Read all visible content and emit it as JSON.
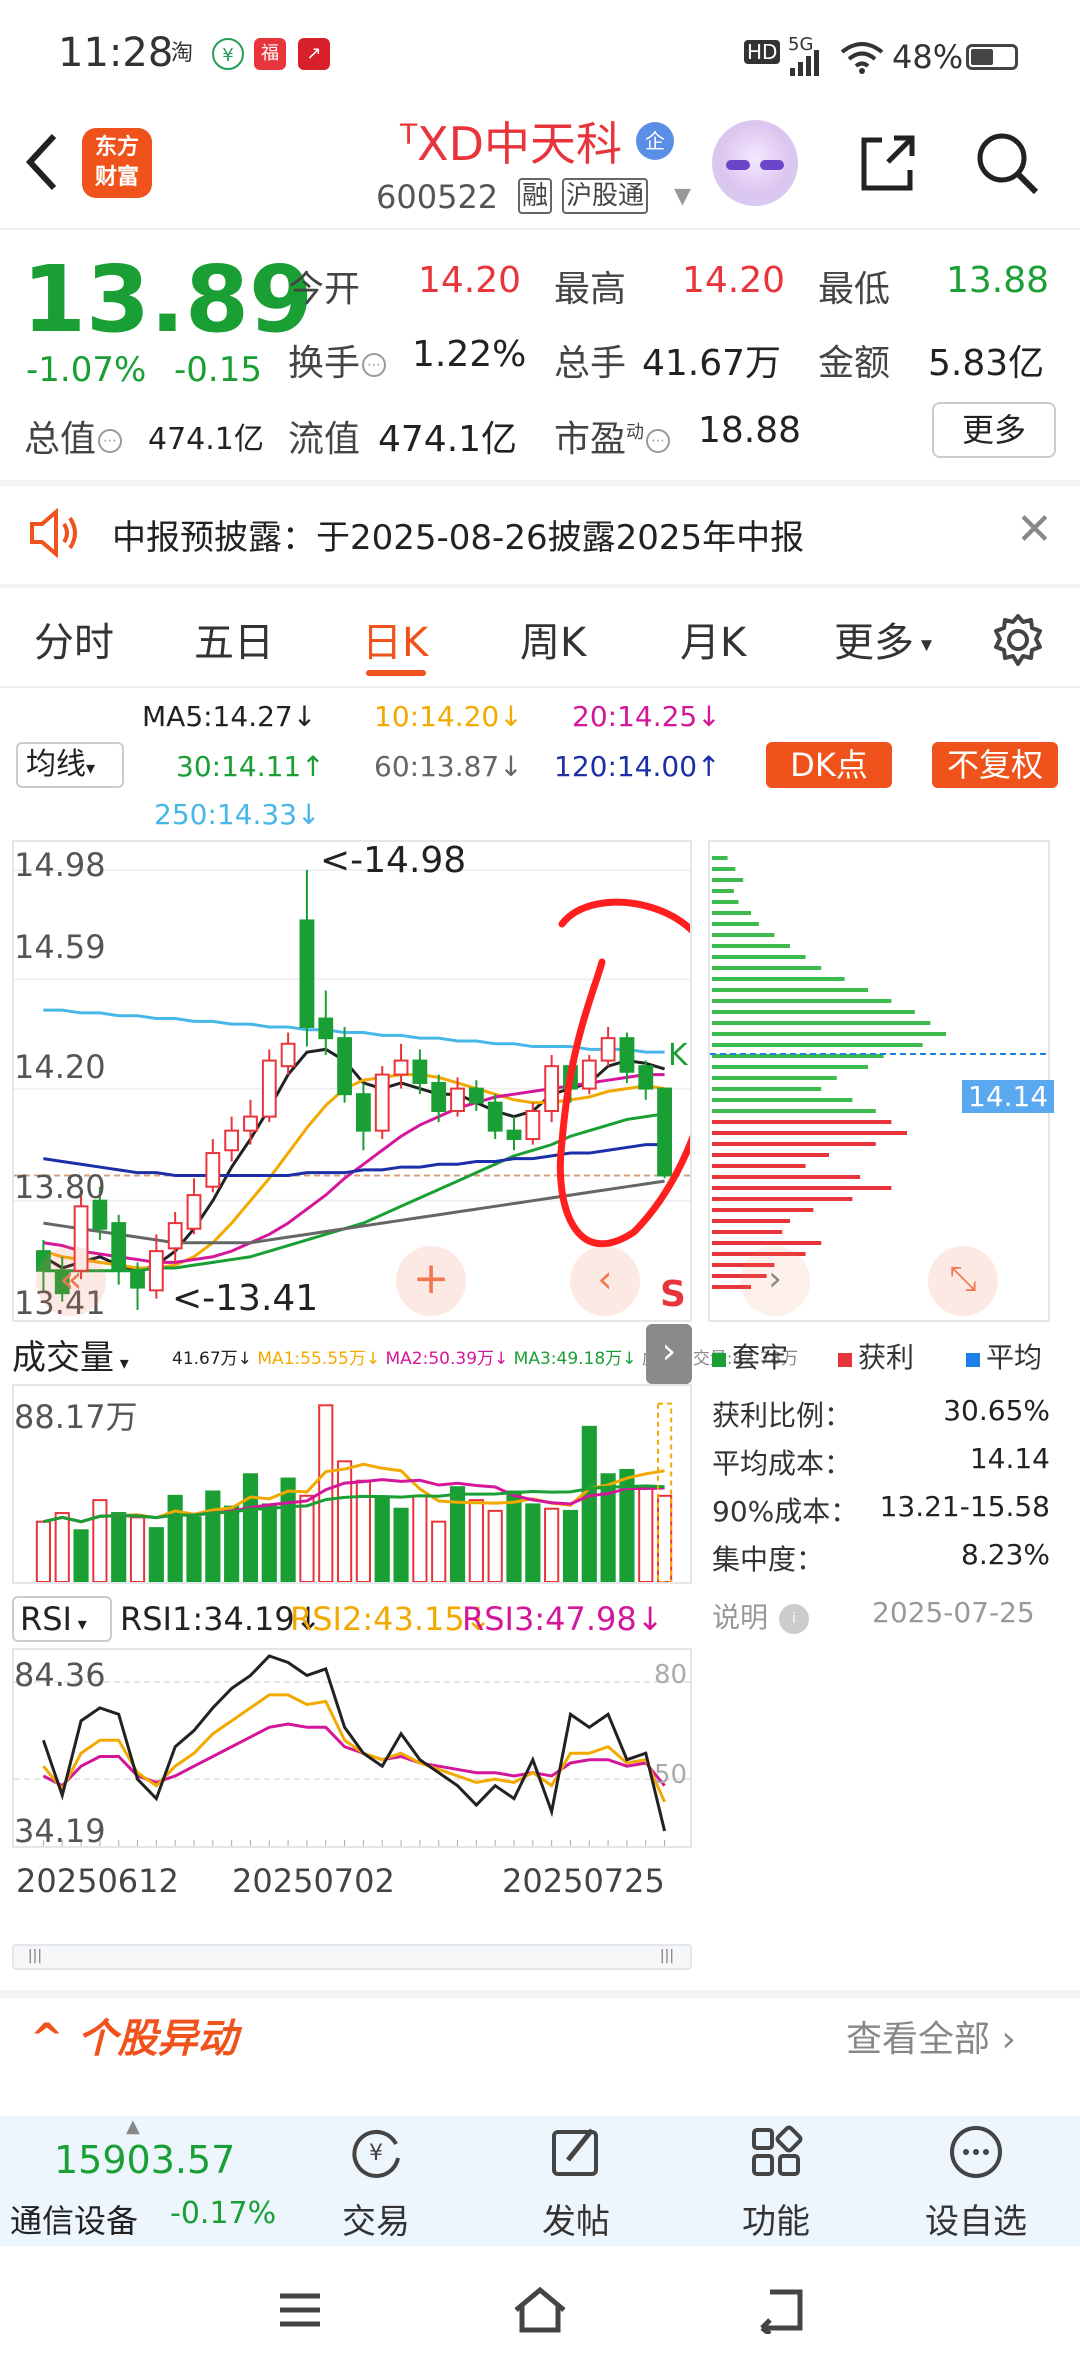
{
  "status_bar": {
    "time": "11:28",
    "battery": "48%",
    "net": "5G",
    "hd": "HD"
  },
  "header": {
    "back": "<",
    "logo_line1": "东方",
    "logo_line2": "财富",
    "prefix": "T",
    "name": "XD中天科",
    "badge": "企",
    "code": "600522",
    "tags": [
      "融",
      "沪股通"
    ]
  },
  "quote": {
    "price": "13.89",
    "change_pct": "-1.07%",
    "change": "-0.15",
    "open_label": "今开",
    "open": "14.20",
    "high_label": "最高",
    "high": "14.20",
    "low_label": "最低",
    "low": "13.88",
    "turnover_label": "换手",
    "turnover": "1.22%",
    "volume_label": "总手",
    "volume": "41.67万",
    "amount_label": "金额",
    "amount": "5.83亿",
    "mktcap_label": "总值",
    "mktcap": "474.1亿",
    "float_label": "流值",
    "float": "474.1亿",
    "pe_label": "市盈",
    "pe_sup": "动",
    "pe": "18.88",
    "more": "更多"
  },
  "notice": {
    "text": "中报预披露：于2025-08-26披露2025年中报"
  },
  "tabs": [
    "分时",
    "五日",
    "日K",
    "周K",
    "月K",
    "更多"
  ],
  "ma_legend": {
    "select": "均线",
    "ma5": "MA5:14.27↓",
    "ma10": "10:14.20↓",
    "ma20": "20:14.25↓",
    "ma30": "30:14.11↑",
    "ma60": "60:13.87↓",
    "ma120": "120:14.00↑",
    "ma250": "250:14.33↓",
    "dk": "DK点",
    "fq": "不复权",
    "colors": {
      "ma5": "#222222",
      "ma10": "#f2a900",
      "ma20": "#d4169a",
      "ma30": "#1a9f35",
      "ma60": "#666666",
      "ma120": "#1c2fa8",
      "ma250": "#47b7e8"
    }
  },
  "chart_data": [
    {
      "type": "candlestick",
      "y_ticks": [
        "14.98",
        "14.59",
        "14.20",
        "13.80",
        "13.41"
      ],
      "ylim": [
        13.41,
        14.98
      ],
      "high_annot": "<-14.98",
      "low_annot": "<-13.41",
      "last_label": "14.14",
      "s_marker": "S",
      "candles": [
        {
          "o": 13.62,
          "c": 13.55,
          "h": 13.66,
          "l": 13.48
        },
        {
          "o": 13.55,
          "c": 13.47,
          "h": 13.6,
          "l": 13.44
        },
        {
          "o": 13.55,
          "c": 13.78,
          "h": 13.83,
          "l": 13.52
        },
        {
          "o": 13.8,
          "c": 13.7,
          "h": 13.85,
          "l": 13.66
        },
        {
          "o": 13.72,
          "c": 13.55,
          "h": 13.75,
          "l": 13.5
        },
        {
          "o": 13.55,
          "c": 13.49,
          "h": 13.58,
          "l": 13.41
        },
        {
          "o": 13.48,
          "c": 13.62,
          "h": 13.68,
          "l": 13.45
        },
        {
          "o": 13.63,
          "c": 13.72,
          "h": 13.76,
          "l": 13.58
        },
        {
          "o": 13.7,
          "c": 13.82,
          "h": 13.88,
          "l": 13.68
        },
        {
          "o": 13.85,
          "c": 13.97,
          "h": 14.02,
          "l": 13.83
        },
        {
          "o": 13.98,
          "c": 14.05,
          "h": 14.1,
          "l": 13.94
        },
        {
          "o": 14.05,
          "c": 14.1,
          "h": 14.16,
          "l": 14.0
        },
        {
          "o": 14.1,
          "c": 14.3,
          "h": 14.34,
          "l": 14.08
        },
        {
          "o": 14.28,
          "c": 14.36,
          "h": 14.4,
          "l": 14.25
        },
        {
          "o": 14.8,
          "c": 14.42,
          "h": 14.98,
          "l": 14.35
        },
        {
          "o": 14.45,
          "c": 14.38,
          "h": 14.55,
          "l": 14.32
        },
        {
          "o": 14.38,
          "c": 14.18,
          "h": 14.42,
          "l": 14.15
        },
        {
          "o": 14.18,
          "c": 14.05,
          "h": 14.22,
          "l": 13.98
        },
        {
          "o": 14.05,
          "c": 14.25,
          "h": 14.28,
          "l": 14.02
        },
        {
          "o": 14.25,
          "c": 14.3,
          "h": 14.36,
          "l": 14.2
        },
        {
          "o": 14.3,
          "c": 14.22,
          "h": 14.34,
          "l": 14.18
        },
        {
          "o": 14.22,
          "c": 14.12,
          "h": 14.25,
          "l": 14.08
        },
        {
          "o": 14.12,
          "c": 14.2,
          "h": 14.24,
          "l": 14.1
        },
        {
          "o": 14.2,
          "c": 14.15,
          "h": 14.23,
          "l": 14.12
        },
        {
          "o": 14.15,
          "c": 14.05,
          "h": 14.18,
          "l": 14.02
        },
        {
          "o": 14.05,
          "c": 14.02,
          "h": 14.1,
          "l": 13.98
        },
        {
          "o": 14.02,
          "c": 14.12,
          "h": 14.15,
          "l": 14.0
        },
        {
          "o": 14.12,
          "c": 14.28,
          "h": 14.32,
          "l": 14.08
        },
        {
          "o": 14.28,
          "c": 14.2,
          "h": 14.3,
          "l": 14.15
        },
        {
          "o": 14.2,
          "c": 14.3,
          "h": 14.32,
          "l": 14.18
        },
        {
          "o": 14.3,
          "c": 14.38,
          "h": 14.42,
          "l": 14.28
        },
        {
          "o": 14.38,
          "c": 14.26,
          "h": 14.4,
          "l": 14.22
        },
        {
          "o": 14.28,
          "c": 14.2,
          "h": 14.3,
          "l": 14.16
        },
        {
          "o": 14.2,
          "c": 13.89,
          "h": 14.2,
          "l": 13.88
        }
      ],
      "ma_lines": {
        "ma5": [
          13.6,
          13.56,
          13.58,
          13.6,
          13.57,
          13.55,
          13.57,
          13.62,
          13.7,
          13.8,
          13.92,
          14.02,
          14.13,
          14.25,
          14.33,
          14.34,
          14.3,
          14.22,
          14.2,
          14.22,
          14.2,
          14.18,
          14.18,
          14.15,
          14.12,
          14.1,
          14.12,
          14.18,
          14.2,
          14.22,
          14.28,
          14.3,
          14.29,
          14.27
        ],
        "ma10": [
          13.62,
          13.6,
          13.59,
          13.58,
          13.57,
          13.56,
          13.56,
          13.57,
          13.6,
          13.65,
          13.72,
          13.8,
          13.88,
          13.97,
          14.06,
          14.14,
          14.2,
          14.23,
          14.24,
          14.25,
          14.25,
          14.24,
          14.22,
          14.2,
          14.18,
          14.16,
          14.15,
          14.15,
          14.16,
          14.17,
          14.19,
          14.2,
          14.21,
          14.2
        ],
        "ma20": [
          13.65,
          13.64,
          13.62,
          13.61,
          13.6,
          13.59,
          13.58,
          13.58,
          13.59,
          13.6,
          13.62,
          13.65,
          13.68,
          13.72,
          13.77,
          13.82,
          13.88,
          13.93,
          13.98,
          14.03,
          14.07,
          14.1,
          14.13,
          14.15,
          14.17,
          14.18,
          14.19,
          14.2,
          14.21,
          14.22,
          14.23,
          14.24,
          14.25,
          14.25
        ],
        "ma30": [
          13.55,
          13.55,
          13.55,
          13.55,
          13.55,
          13.55,
          13.56,
          13.56,
          13.57,
          13.58,
          13.59,
          13.6,
          13.62,
          13.64,
          13.66,
          13.68,
          13.7,
          13.72,
          13.75,
          13.78,
          13.81,
          13.84,
          13.87,
          13.9,
          13.93,
          13.96,
          13.98,
          14.0,
          14.03,
          14.05,
          14.07,
          14.09,
          14.1,
          14.11
        ],
        "ma60": [
          13.72,
          13.71,
          13.7,
          13.69,
          13.68,
          13.67,
          13.66,
          13.65,
          13.65,
          13.65,
          13.65,
          13.65,
          13.66,
          13.67,
          13.68,
          13.69,
          13.7,
          13.71,
          13.72,
          13.73,
          13.74,
          13.75,
          13.76,
          13.77,
          13.78,
          13.79,
          13.8,
          13.81,
          13.82,
          13.83,
          13.84,
          13.85,
          13.86,
          13.87
        ],
        "ma120": [
          13.95,
          13.94,
          13.93,
          13.92,
          13.91,
          13.9,
          13.9,
          13.89,
          13.89,
          13.89,
          13.89,
          13.89,
          13.89,
          13.89,
          13.9,
          13.9,
          13.9,
          13.91,
          13.91,
          13.92,
          13.92,
          13.93,
          13.93,
          13.94,
          13.94,
          13.95,
          13.95,
          13.96,
          13.97,
          13.97,
          13.98,
          13.99,
          14.0,
          14.0
        ],
        "ma250": [
          14.48,
          14.48,
          14.47,
          14.47,
          14.46,
          14.46,
          14.45,
          14.45,
          14.44,
          14.44,
          14.43,
          14.43,
          14.42,
          14.42,
          14.41,
          14.41,
          14.4,
          14.4,
          14.39,
          14.39,
          14.38,
          14.38,
          14.37,
          14.37,
          14.36,
          14.36,
          14.35,
          14.35,
          14.35,
          14.34,
          14.34,
          14.34,
          14.33,
          14.33
        ]
      }
    },
    {
      "type": "bar",
      "title": "成交量",
      "labels": {
        "vol": "41.67万↓",
        "ma1": "MA1:55.55万↓",
        "ma2": "MA2:50.39万↓",
        "ma3": "MA3:49.18万↓",
        "virt": "虚拟成交量:82.78万"
      },
      "ymax_label": "88.17万",
      "ylim": [
        0,
        88.17
      ],
      "values": [
        28,
        32,
        24,
        38,
        32,
        30,
        25,
        40,
        30,
        42,
        35,
        50,
        36,
        48,
        40,
        82,
        56,
        47,
        39,
        34,
        40,
        28,
        44,
        38,
        33,
        42,
        36,
        34,
        33,
        72,
        50,
        52,
        44,
        40
      ],
      "up": [
        false,
        false,
        true,
        false,
        true,
        false,
        true,
        true,
        true,
        true,
        true,
        true,
        true,
        true,
        false,
        false,
        false,
        false,
        true,
        true,
        false,
        false,
        true,
        false,
        false,
        true,
        true,
        false,
        true,
        true,
        true,
        true,
        false,
        false
      ]
    },
    {
      "type": "line",
      "title": "RSI",
      "labels": {
        "rsi1": "RSI1:34.19↓",
        "rsi2": "RSI2:43.15↓",
        "rsi3": "RSI3:47.98↓"
      },
      "y_ticks": [
        "84.36",
        "34.19"
      ],
      "right_ticks": [
        "80",
        "50"
      ],
      "ylim": [
        30,
        88
      ],
      "x_labels": [
        "20250612",
        "20250702",
        "20250725"
      ],
      "rsi1": [
        62,
        45,
        68,
        72,
        70,
        50,
        44,
        60,
        65,
        72,
        78,
        82,
        88,
        86,
        82,
        84,
        66,
        58,
        54,
        64,
        56,
        52,
        48,
        42,
        48,
        44,
        56,
        40,
        70,
        66,
        70,
        56,
        58,
        34
      ],
      "rsi2": [
        54,
        47,
        58,
        62,
        62,
        52,
        48,
        54,
        58,
        64,
        68,
        72,
        76,
        76,
        73,
        74,
        62,
        58,
        56,
        58,
        55,
        53,
        51,
        49,
        50,
        49,
        52,
        48,
        58,
        58,
        60,
        55,
        56,
        43
      ],
      "rsi3": [
        51,
        48,
        54,
        57,
        57,
        51,
        49,
        51,
        54,
        57,
        60,
        63,
        66,
        67,
        66,
        66,
        60,
        58,
        56,
        57,
        55,
        54,
        53,
        52,
        52,
        51,
        52,
        51,
        55,
        56,
        56,
        54,
        55,
        48
      ]
    }
  ],
  "side_panel": {
    "legend": [
      "套牢",
      "获利",
      "平均"
    ],
    "legend_colors": [
      "#1a9f35",
      "#e8343b",
      "#1c7fe8"
    ],
    "rows": [
      {
        "label": "获利比例：",
        "value": "30.65%"
      },
      {
        "label": "平均成本：",
        "value": "14.14"
      },
      {
        "label": "90%成本：",
        "value": "13.21-15.58"
      },
      {
        "label": "集中度：",
        "value": "8.23%"
      }
    ],
    "note_label": "说明",
    "date": "2025-07-25"
  },
  "movement": {
    "title": "个股异动",
    "view_all": "查看全部"
  },
  "bottom_bar": {
    "index_value": "15903.57",
    "index_name": "通信设备",
    "index_change": "-0.17%",
    "items": [
      "交易",
      "发帖",
      "功能",
      "设自选"
    ]
  }
}
